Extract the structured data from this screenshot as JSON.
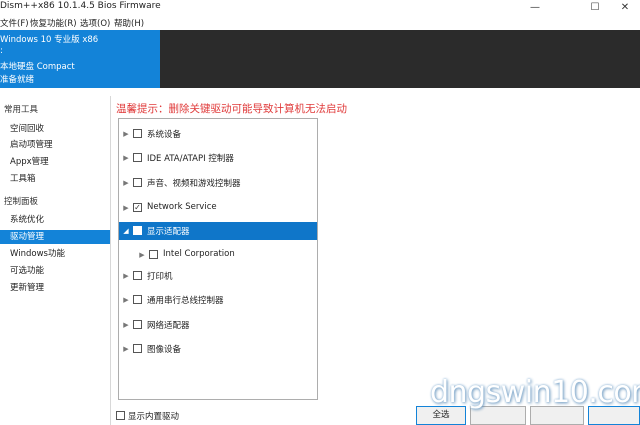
{
  "window": {
    "title": "Dism++x86 10.1.4.5 Bios Firmware",
    "min_glyph": "—",
    "max_glyph": "☐",
    "close_glyph": "✕"
  },
  "menu": [
    "文件(F)",
    "恢复功能(R)",
    "选项(O)",
    "帮助(H)"
  ],
  "header": {
    "os_name": "Windows 10 专业版 x86",
    "line2": ":",
    "disk": "本地硬盘 Compact",
    "status": "准备就绪"
  },
  "sidebar": {
    "groups": [
      {
        "label": "常用工具",
        "items": [
          "空间回收",
          "启动项管理",
          "Appx管理",
          "工具箱"
        ]
      },
      {
        "label": "控制面板",
        "items": [
          "系统优化",
          "驱动管理",
          "Windows功能",
          "可选功能",
          "更新管理"
        ]
      }
    ],
    "active": "驱动管理"
  },
  "warning": "温馨提示：删除关键驱动可能导致计算机无法启动",
  "tree": {
    "nodes": [
      {
        "label": "系统设备",
        "expander": "▶",
        "check": ""
      },
      {
        "label": "IDE ATA/ATAPI 控制器",
        "expander": "▶",
        "check": ""
      },
      {
        "label": "声音、视频和游戏控制器",
        "expander": "▶",
        "check": ""
      },
      {
        "label": "Network Service",
        "expander": "▶",
        "check": "✓"
      },
      {
        "label": "显示适配器",
        "expander": "◢",
        "check": "",
        "selected": true
      },
      {
        "label": "Intel Corporation",
        "expander": "▶",
        "check": "",
        "indent": 1
      },
      {
        "label": "打印机",
        "expander": "▶",
        "check": ""
      },
      {
        "label": "通用串行总线控制器",
        "expander": "▶",
        "check": ""
      },
      {
        "label": "网络适配器",
        "expander": "▶",
        "check": ""
      },
      {
        "label": "图像设备",
        "expander": "▶",
        "check": ""
      }
    ]
  },
  "footer": {
    "show_builtin": "显示内置驱动",
    "select_all": "全选"
  },
  "watermark": "dngswin10.com",
  "colors": {
    "accent": "#1383d8",
    "selected_row": "#0f76c9",
    "warning": "#e03a3a",
    "header_dark": "#2b2b2b"
  }
}
